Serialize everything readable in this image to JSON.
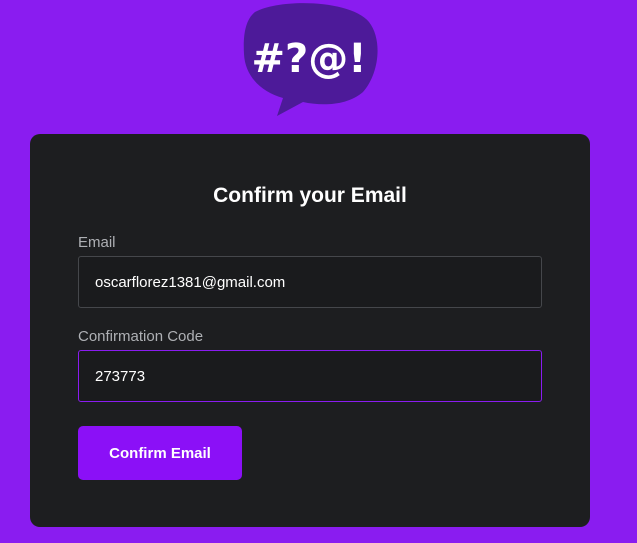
{
  "logo": {
    "text": "#?@!",
    "bubble_color": "#4d1a99",
    "text_color": "#ffffff"
  },
  "form": {
    "title": "Confirm your Email",
    "email": {
      "label": "Email",
      "value": "oscarflorez1381@gmail.com"
    },
    "code": {
      "label": "Confirmation Code",
      "value": "273773"
    },
    "submit_label": "Confirm Email"
  },
  "colors": {
    "background": "#8a1cf0",
    "card": "#1d1e20",
    "accent": "#8b10f7"
  }
}
